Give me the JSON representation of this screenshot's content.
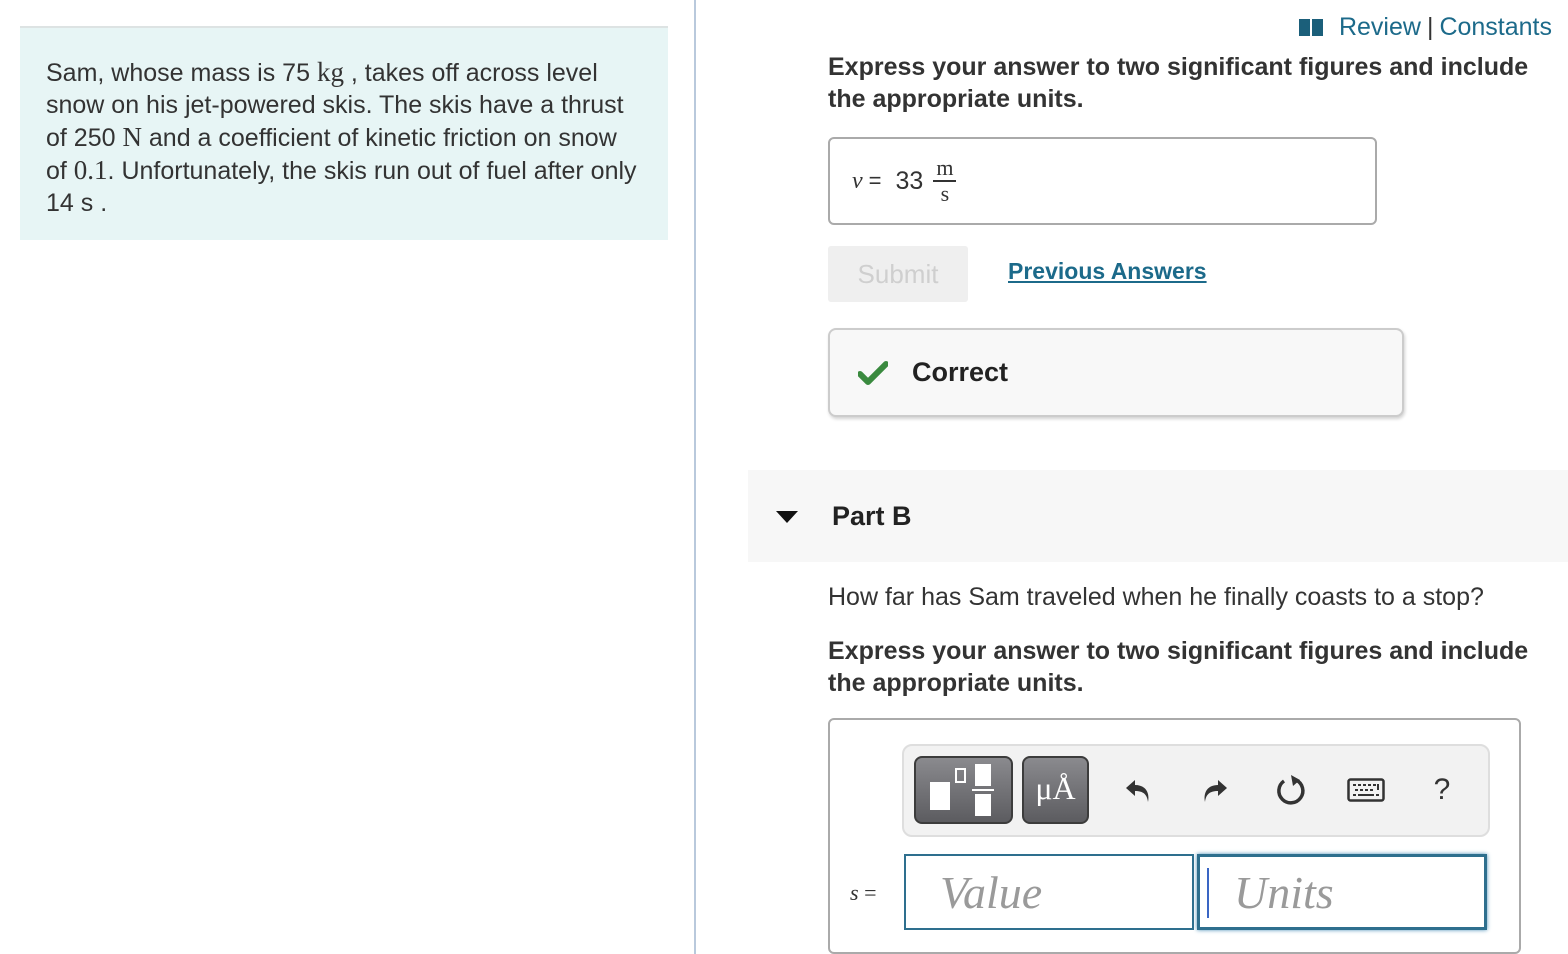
{
  "problem": {
    "segments": [
      {
        "text": "Sam, whose mass is 75 ",
        "math": false
      },
      {
        "text": "kg",
        "math": true
      },
      {
        "text": " , takes off across level snow on his jet-powered skis. The skis have a thrust of 250 ",
        "math": false
      },
      {
        "text": "N",
        "math": true
      },
      {
        "text": " and a coefficient of kinetic friction on snow of ",
        "math": false
      },
      {
        "text": "0.1",
        "math": true
      },
      {
        "text": ". Unfortunately, the skis run out of fuel after only 14 s .",
        "math": false
      }
    ]
  },
  "header": {
    "review_label": "Review",
    "separator": "|",
    "constants_label": "Constants",
    "icon": "book-icon"
  },
  "part_a": {
    "instruction": "Express your answer to two significant figures and include the appropriate units.",
    "answer": {
      "variable": "v",
      "equals": "=",
      "value": "33",
      "unit_numerator": "m",
      "unit_denominator": "s"
    },
    "submit_label": "Submit",
    "submit_disabled": true,
    "previous_answers_label": "Previous Answers",
    "feedback": {
      "status": "Correct",
      "icon": "check-icon",
      "color": "#3a8a3f"
    }
  },
  "part_b": {
    "title": "Part B",
    "expanded": true,
    "question": "How far has Sam traveled when he finally coasts to a stop?",
    "instruction": "Express your answer to two significant figures and include the appropriate units.",
    "toolbar": {
      "templates_icon": "templates-icon",
      "units_label": "μÅ",
      "undo_icon": "undo-icon",
      "redo_icon": "redo-icon",
      "reset_icon": "reset-icon",
      "keyboard_icon": "keyboard-icon",
      "help_label": "?"
    },
    "answer": {
      "variable": "s",
      "equals": "=",
      "value_placeholder": "Value",
      "units_placeholder": "Units",
      "value": "",
      "units": ""
    }
  },
  "colors": {
    "link": "#1c6a8a",
    "problem_bg": "#e7f5f5",
    "input_border": "#2e6f8e",
    "correct": "#3a8a3f"
  }
}
